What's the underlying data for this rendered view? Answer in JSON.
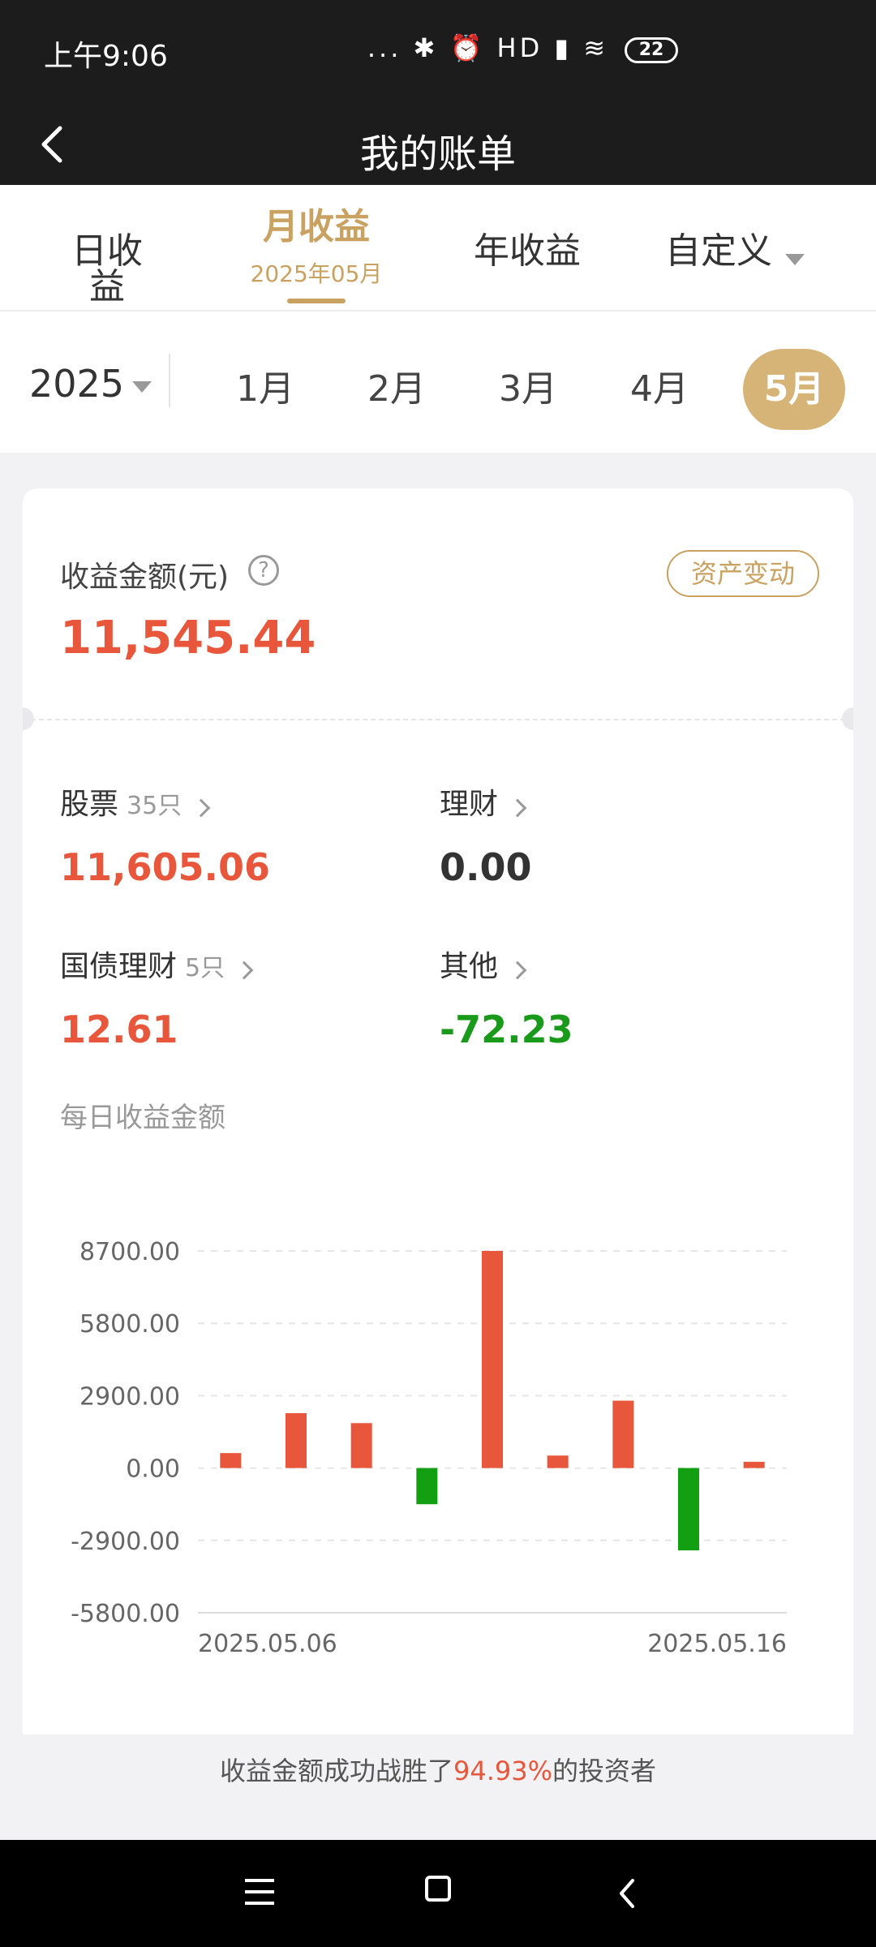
{
  "status": {
    "time": "上午9:06",
    "icons": "... ✱ ⏰ HD ▮ ≋",
    "battery": "22"
  },
  "nav": {
    "title": "我的账单"
  },
  "tabs": [
    {
      "label": "日收益"
    },
    {
      "label": "月收益",
      "sub": "2025年05月"
    },
    {
      "label": "年收益"
    },
    {
      "label": "自定义"
    }
  ],
  "year": "2025",
  "months": [
    "1月",
    "2月",
    "3月",
    "4月",
    "5月"
  ],
  "summary": {
    "label": "收益金额(元)",
    "help": "?",
    "asset_button": "资产变动",
    "total": "11,545.44"
  },
  "items": [
    {
      "label": "股票",
      "count": "35只",
      "value": "11,605.06"
    },
    {
      "label": "理财",
      "count": "",
      "value": "0.00"
    },
    {
      "label": "国债理财",
      "count": "5只",
      "value": "12.61"
    },
    {
      "label": "其他",
      "count": "",
      "value": "-72.23"
    }
  ],
  "daily_title": "每日收益金额",
  "colors": {
    "positive": "#e8573c",
    "negative": "#12a012",
    "accent": "#c9a160"
  },
  "chart_data": {
    "type": "bar",
    "x_labels": [
      "2025.05.06",
      "2025.05.16"
    ],
    "values": [
      600,
      2200,
      1800,
      -1450,
      8700,
      500,
      2700,
      -3300,
      250
    ],
    "yticks": [
      8700,
      5800,
      2900,
      0,
      -2900,
      -5800
    ],
    "ytick_labels": [
      "8700.00",
      "5800.00",
      "2900.00",
      "0.00",
      "-2900.00",
      "-5800.00"
    ],
    "ylim": [
      -5800,
      8700
    ]
  },
  "footer": {
    "prefix": "收益金额成功战胜了",
    "percent": "94.93%",
    "suffix": "的投资者"
  }
}
